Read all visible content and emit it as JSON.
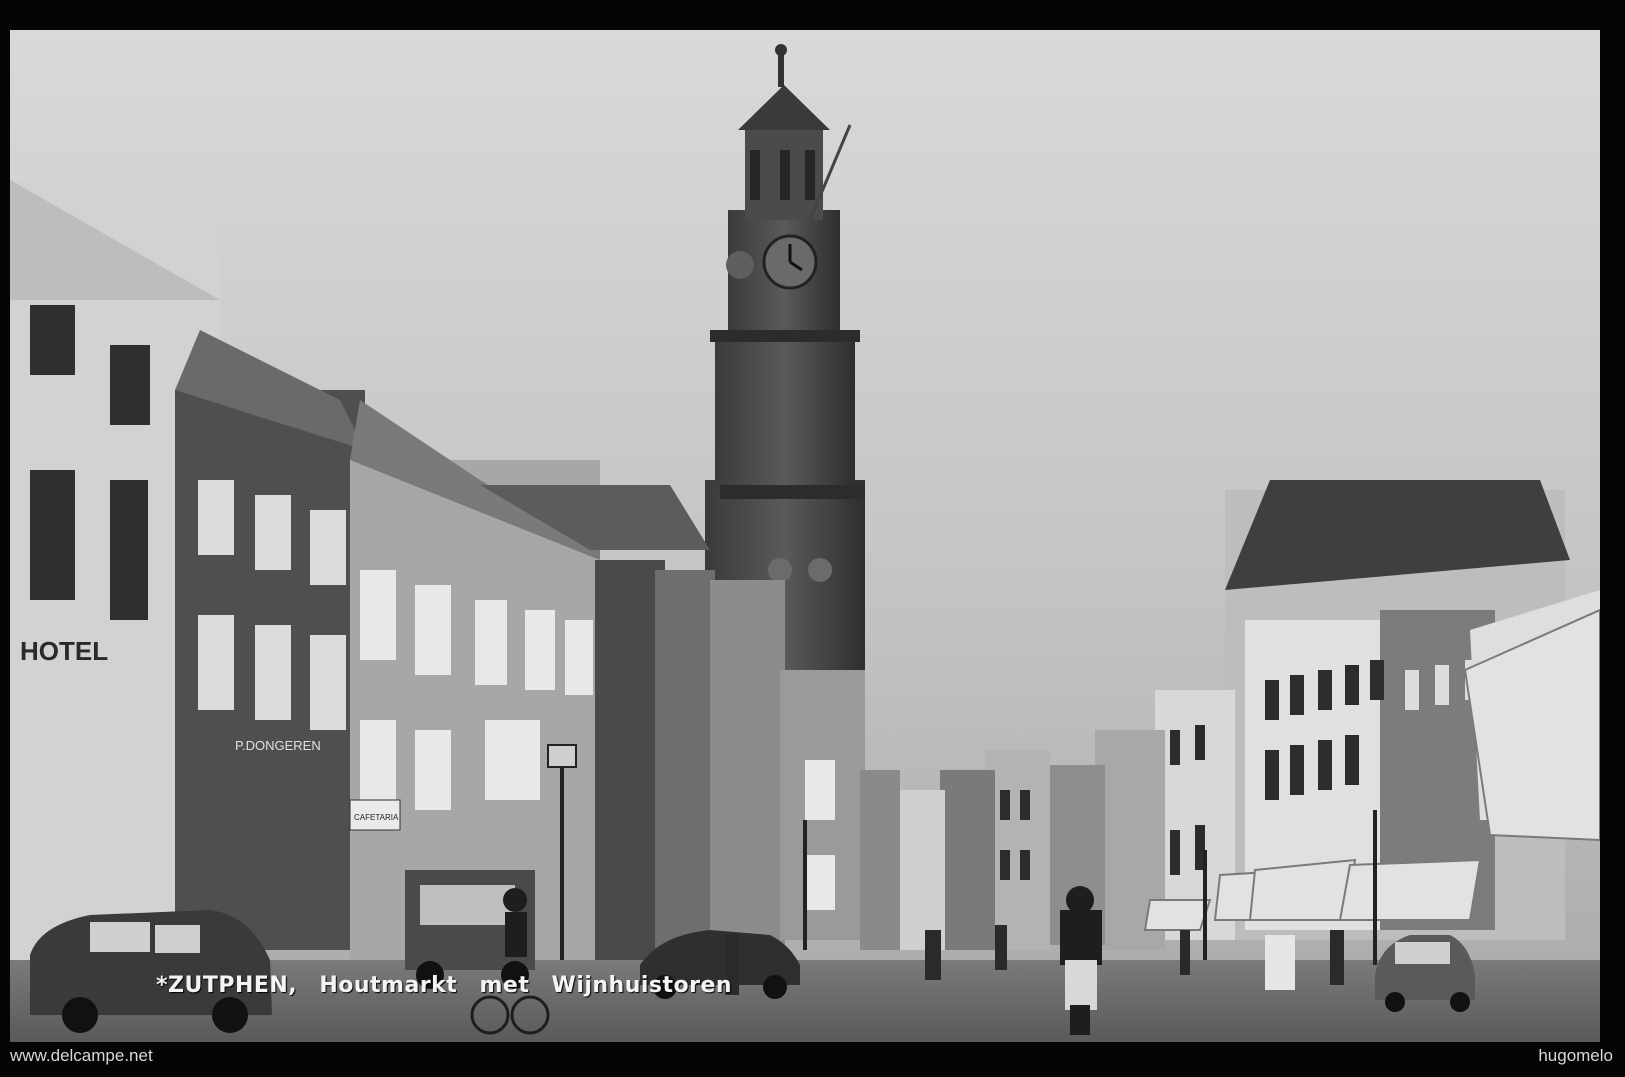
{
  "postcard": {
    "caption_city": "*ZUTPHEN,",
    "caption_place": "Houtmarkt",
    "caption_with": "met",
    "caption_tower": "Wijnhuistoren",
    "sign_hotel": "HOTEL",
    "sign_shop": "P.DONGEREN",
    "sign_cafe": "CAFETARIA"
  },
  "watermarks": {
    "left": "www.delcampe.net",
    "right": "hugomelo"
  }
}
